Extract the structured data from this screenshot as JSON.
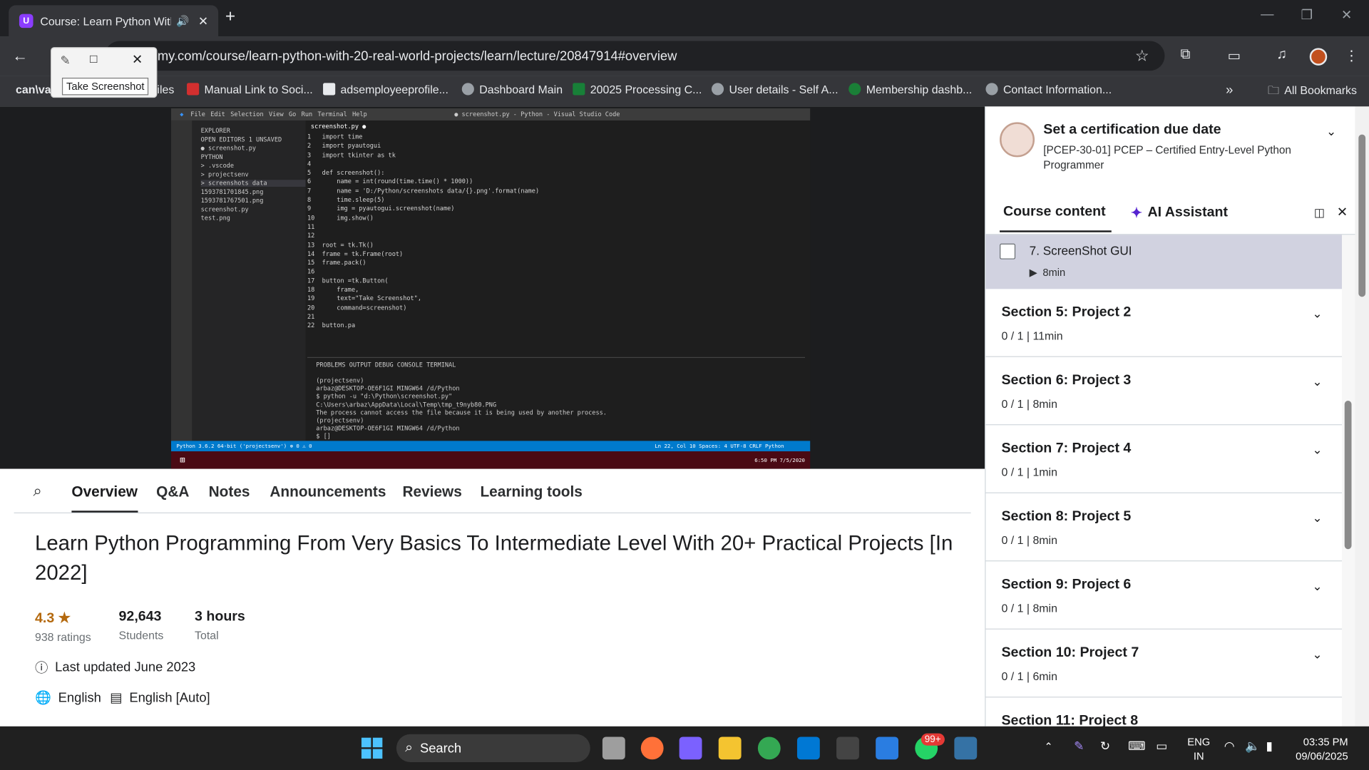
{
  "browser": {
    "tab_title": "Course: Learn Python With",
    "url": "emy.com/course/learn-python-with-20-real-world-projects/learn/lecture/20847914#overview",
    "bookmarks": [
      "can\\vas",
      "iles",
      "Manual Link to Soci...",
      "adsemployeeprofile...",
      "Dashboard Main",
      "20025 Processing C...",
      "User details - Self A...",
      "Membership dashb...",
      "Contact Information..."
    ],
    "all_bookmarks": "All Bookmarks"
  },
  "snip": {
    "label": "Take Screenshot"
  },
  "vscode": {
    "title": "● screenshot.py - Python - Visual Studio Code",
    "menu": [
      "File",
      "Edit",
      "Selection",
      "View",
      "Go",
      "Run",
      "Terminal",
      "Help"
    ],
    "explorer": [
      "EXPLORER",
      "OPEN EDITORS  1 UNSAVED",
      "  ● screenshot.py",
      "PYTHON",
      "  > .vscode",
      "  > projectsenv",
      "  > screenshots data",
      "  1593781701845.png",
      "  1593781767501.png",
      "  screenshot.py",
      "  test.png"
    ],
    "editor_tab": "screenshot.py ●",
    "code": "1   import time\n2   import pyautogui\n3   import tkinter as tk\n4\n5   def screenshot():\n6       name = int(round(time.time() * 1000))\n7       name = 'D:/Python/screenshots data/{}.png'.format(name)\n8       time.sleep(5)\n9       img = pyautogui.screenshot(name)\n10      img.show()\n11\n12\n13  root = tk.Tk()\n14  frame = tk.Frame(root)\n15  frame.pack()\n16\n17  button =tk.Button(\n18      frame,\n19      text=\"Take Screenshot\",\n20      command=screenshot)\n21\n22  button.pa",
    "panel_tabs": "PROBLEMS   OUTPUT   DEBUG CONSOLE   TERMINAL",
    "terminal": "(projectsenv)\narbaz@DESKTOP-OE6F1GI MINGW64 /d/Python\n$ python -u \"d:\\Python\\screenshot.py\"\nC:\\Users\\arbaz\\AppData\\Local\\Temp\\tmp_t9nyb80.PNG\nThe process cannot access the file because it is being used by another process.\n(projectsenv)\narbaz@DESKTOP-OE6F1GI MINGW64 /d/Python\n$ []",
    "status": "Python 3.6.2 64-bit ('projectsenv')   ⊗ 0 ⚠ 0",
    "status_right": "Ln 22, Col 10   Spaces: 4   UTF-8   CRLF   Python",
    "clock": "6:50 PM 7/5/2020"
  },
  "tabs": [
    "Overview",
    "Q&A",
    "Notes",
    "Announcements",
    "Reviews",
    "Learning tools"
  ],
  "course": {
    "title": "Learn Python Programming From Very Basics To Intermediate Level With 20+ Practical Projects [In 2022]",
    "rating": "4.3",
    "ratings_label": "938 ratings",
    "students": "92,643",
    "students_label": "Students",
    "hours": "3 hours",
    "hours_label": "Total",
    "updated": "Last updated June 2023",
    "language": "English",
    "captions": "English [Auto]"
  },
  "sidebar": {
    "cert_title": "Set a certification due date",
    "cert_sub": "[PCEP-30-01] PCEP – Certified Entry-Level Python Programmer",
    "tab_content": "Course content",
    "tab_ai": "AI Assistant",
    "current_lecture": "7. ScreenShot GUI",
    "current_duration": "8min",
    "sections": [
      {
        "title": "Section 5: Project 2",
        "sub": "0 / 1 | 11min"
      },
      {
        "title": "Section 6: Project 3",
        "sub": "0 / 1 | 8min"
      },
      {
        "title": "Section 7: Project 4",
        "sub": "0 / 1 | 1min"
      },
      {
        "title": "Section 8: Project 5",
        "sub": "0 / 1 | 8min"
      },
      {
        "title": "Section 9: Project 6",
        "sub": "0 / 1 | 8min"
      },
      {
        "title": "Section 10: Project 7",
        "sub": "0 / 1 | 6min"
      },
      {
        "title": "Section 11: Project 8",
        "sub": ""
      }
    ]
  },
  "taskbar": {
    "search": "Search",
    "badge": "99+",
    "lang": "ENG",
    "region": "IN",
    "time": "03:35 PM",
    "date": "09/06/2025"
  }
}
